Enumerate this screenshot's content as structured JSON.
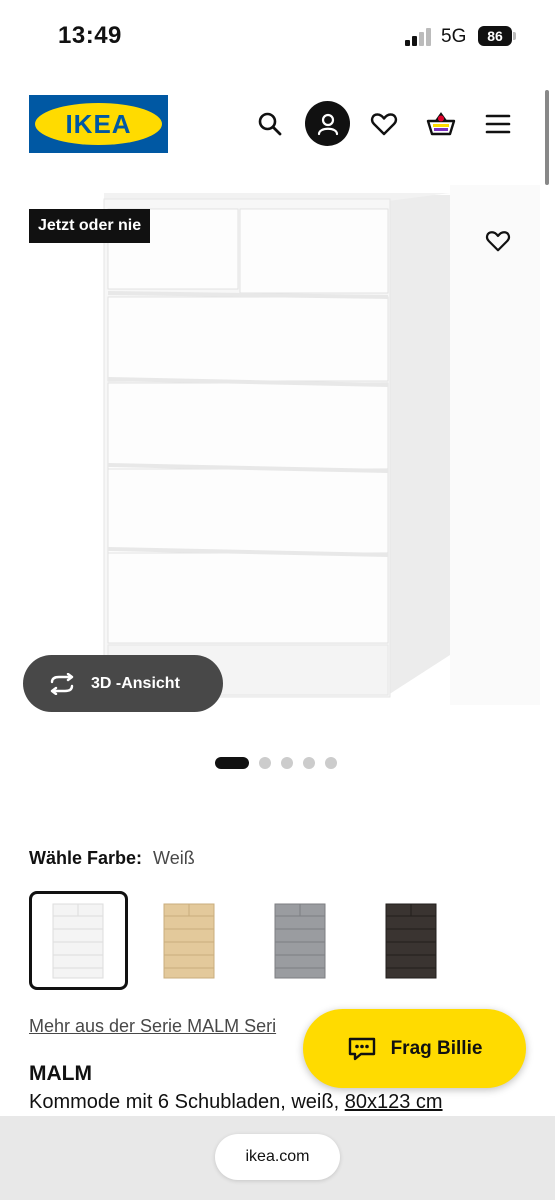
{
  "status_bar": {
    "time": "13:49",
    "network": "5G",
    "battery": "86"
  },
  "header": {
    "logo_text": "IKEA",
    "icons": [
      "search-icon",
      "user-icon",
      "heart-icon",
      "basket-icon",
      "menu-icon"
    ]
  },
  "hero": {
    "badge": "Jetzt oder nie",
    "view3d_label": "3D -Ansicht",
    "carousel_count": 5,
    "carousel_active": 1
  },
  "color": {
    "label": "Wähle Farbe:",
    "selected": "Weiß",
    "swatches": [
      {
        "name": "white",
        "color": "#f4f4f4"
      },
      {
        "name": "oak",
        "color": "#e3c99b"
      },
      {
        "name": "grey",
        "color": "#9a9ca0"
      },
      {
        "name": "black-brown",
        "color": "#3a3431"
      }
    ]
  },
  "series_link": "Mehr aus der Serie MALM Seri",
  "product": {
    "name": "MALM",
    "desc": "Kommode mit 6 Schubladen, weiß, ",
    "size": "80x123 cm"
  },
  "chat": {
    "label": "Frag Billie"
  },
  "browser": {
    "url": "ikea.com"
  },
  "colors": {
    "ikea_blue": "#0058a3",
    "ikea_yellow": "#ffdb00"
  }
}
